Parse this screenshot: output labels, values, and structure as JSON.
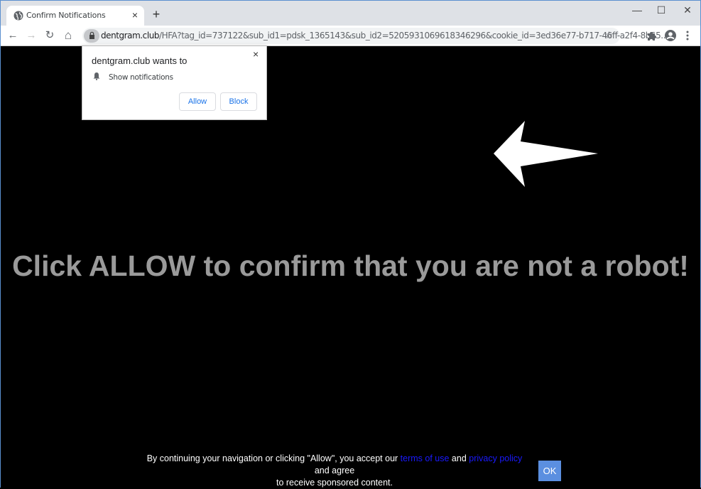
{
  "browser": {
    "tab": {
      "title": "Confirm Notifications",
      "favicon": "globe-icon",
      "close": "×"
    },
    "new_tab": "+",
    "window_controls": {
      "minimize": "—",
      "maximize": "☐",
      "close": "✕"
    },
    "nav": {
      "back": "←",
      "forward": "→",
      "reload": "↻",
      "home": "⌂"
    },
    "url": {
      "host": "dentgram.club",
      "path": "/HFA?tag_id=737122&sub_id1=pdsk_1365143&sub_id2=5205931069618346296&cookie_id=3ed36e77-b717-46ff-a2f4-8b55..."
    },
    "star": "☆",
    "extensions": "✱",
    "profile": "●",
    "menu": "⋮"
  },
  "popup": {
    "title": "dentgram.club wants to",
    "permission": "Show notifications",
    "close": "×",
    "allow_label": "Allow",
    "block_label": "Block"
  },
  "page": {
    "headline": "Click ALLOW to confirm that you are not a robot!",
    "consent": {
      "prefix": "By continuing your navigation or clicking \"Allow\", you accept our ",
      "terms_link": "terms of use",
      "and": " and ",
      "privacy_link": "privacy policy",
      "suffix1": " and agree",
      "line2": "to receive sponsored content."
    },
    "ok_label": "OK"
  },
  "colors": {
    "headline": "#9a9a9a",
    "link": "#1a1aff",
    "ok_button": "#5b8fe0",
    "popup_button_text": "#1a73e8"
  }
}
